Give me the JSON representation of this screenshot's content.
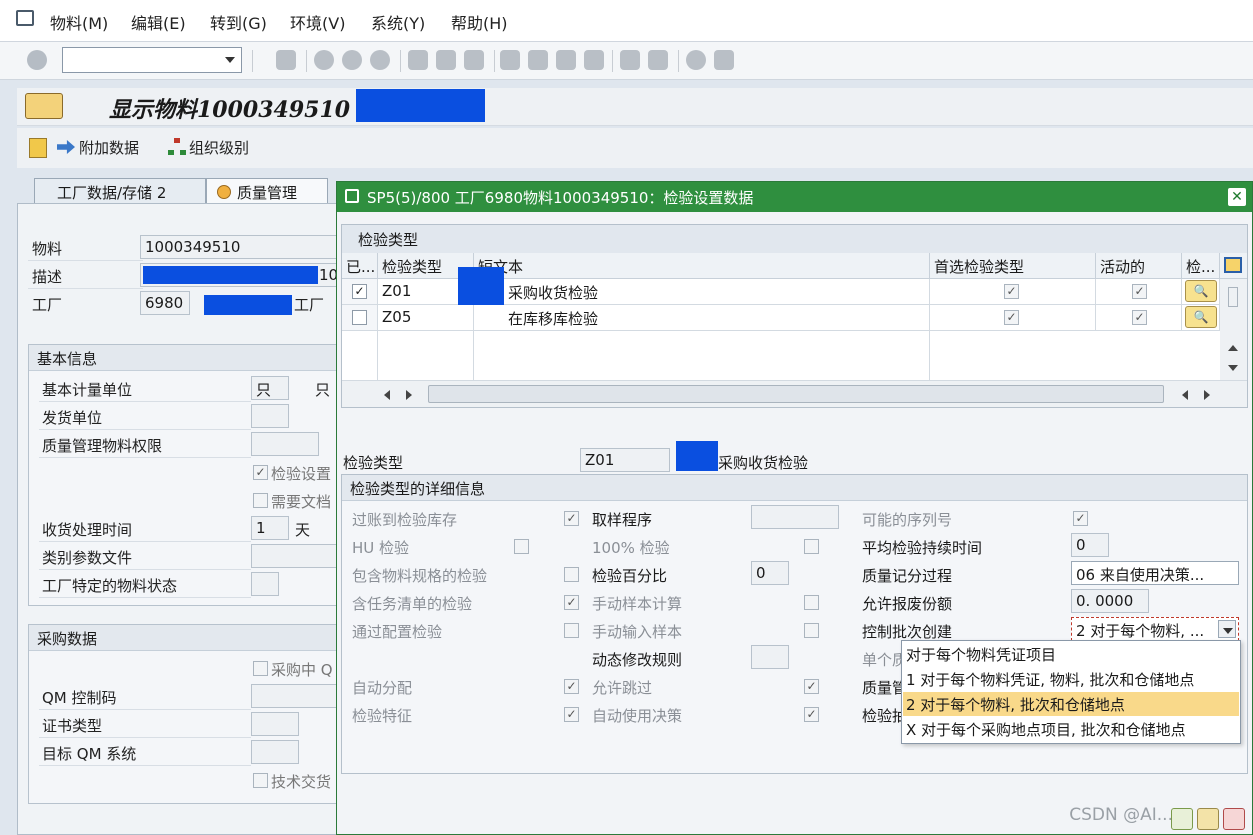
{
  "menu": {
    "items": [
      "物料(M)",
      "编辑(E)",
      "转到(G)",
      "环境(V)",
      "系统(Y)",
      "帮助(H)"
    ]
  },
  "header": {
    "title": "显示物料1000349510"
  },
  "app_toolbar": {
    "additional_data": "附加数据",
    "org_levels": "组织级别"
  },
  "tabs": [
    {
      "label": "工厂数据/存储 2"
    },
    {
      "label": "质量管理"
    }
  ],
  "main": {
    "material_label": "物料",
    "material_value": "1000349510",
    "desc_label": "描述",
    "desc_suffix": "10",
    "plant_label": "工厂",
    "plant_value": "6980",
    "plant_suffix": "工厂",
    "basic_info": {
      "title": "基本信息",
      "uom_label": "基本计量单位",
      "uom_value": "只",
      "uom_text": "只",
      "issue_unit_label": "发货单位",
      "qm_auth_label": "质量管理物料权限",
      "insp_setup_label": "检验设置",
      "docs_required_label": "需要文档",
      "gr_time_label": "收货处理时间",
      "gr_time_value": "1",
      "gr_time_unit": "天",
      "class_label": "类别参数文件",
      "plant_status_label": "工厂特定的物料状态"
    },
    "purchasing": {
      "title": "采购数据",
      "qm_in_proc_label": "采购中 Q",
      "qm_control_label": "QM 控制码",
      "cert_type_label": "证书类型",
      "target_qm_label": "目标 QM 系统",
      "tech_delivery_label": "技术交货"
    }
  },
  "popup": {
    "title": "SP5(5)/800 工厂6980物料1000349510：检验设置数据",
    "grid": {
      "section_title": "检验类型",
      "columns": [
        "已...",
        "检验类型",
        "短文本",
        "首选检验类型",
        "活动的",
        "检..."
      ],
      "rows": [
        {
          "selected": "✓",
          "type": "Z01",
          "text": "采购收货检验",
          "preferred": "✓",
          "active": "✓"
        },
        {
          "selected": "",
          "type": "Z05",
          "text": "在库移库检验",
          "preferred": "✓",
          "active": "✓"
        }
      ]
    },
    "insp_type_label": "检验类型",
    "insp_type_value": "Z01",
    "insp_type_text": "采购收货检验",
    "details": {
      "title": "检验类型的详细信息",
      "col1": [
        {
          "label": "过账到检验库存",
          "checked": "✓"
        },
        {
          "label": "HU 检验",
          "checked": ""
        },
        {
          "label": "包含物料规格的检验",
          "checked": ""
        },
        {
          "label": "含任务清单的检验",
          "checked": "✓"
        },
        {
          "label": "通过配置检验",
          "checked": ""
        },
        {
          "label": "自动分配",
          "checked": "✓"
        },
        {
          "label": "检验特征",
          "checked": "✓"
        }
      ],
      "sampling_label": "取样程序",
      "pct100_label": "100% 检验",
      "pct_label": "检验百分比",
      "pct_value": "0",
      "manual_sample_calc_label": "手动样本计算",
      "manual_sample_input_label": "手动输入样本",
      "dyn_rule_label": "动态修改规则",
      "allow_skip_label": "允许跳过",
      "auto_ud_label": "自动使用决策",
      "serial_label": "可能的序列号",
      "avg_duration_label": "平均检验持续时间",
      "avg_duration_value": "0",
      "qscore_label": "质量记分过程",
      "qscore_value": "06 来自使用决策...",
      "scrap_label": "允许报废份额",
      "scrap_value": "0. 0000",
      "lot_control_label": "控制批次创建",
      "lot_control_value": "2 对于每个物料, ...",
      "single_label": "单个质",
      "qm_label": "质量管",
      "insp_label": "检验抽"
    },
    "dropdown": {
      "options": [
        "  对于每个物料凭证项目",
        "1 对于每个物料凭证, 物料, 批次和仓储地点",
        "2 对于每个物料, 批次和仓储地点",
        "X 对于每个采购地点项目, 批次和仓储地点"
      ],
      "highlighted_index": 2
    }
  },
  "watermark": "CSDN @AI...",
  "colors": {
    "popup_header": "#2f8f3f",
    "highlight": "#f9d98a",
    "redaction": "#0a4fe0"
  }
}
